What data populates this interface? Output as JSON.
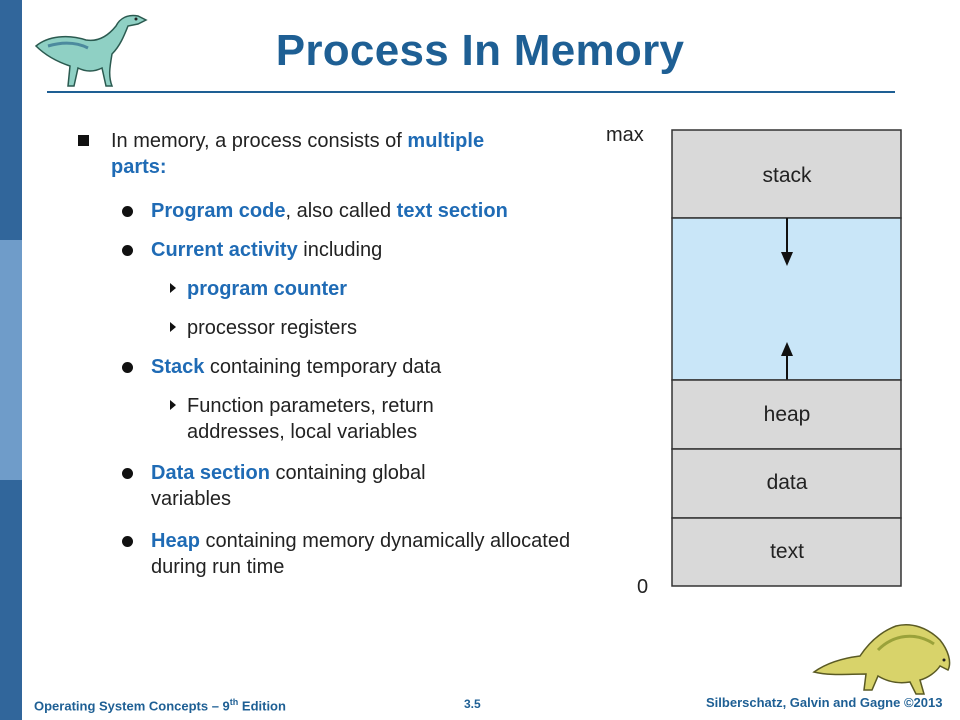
{
  "slide": {
    "title": "Process In Memory"
  },
  "content": {
    "item1": {
      "t1": "In memory, a process consists of ",
      "t2": "multiple",
      "t3": "parts:"
    },
    "item2": {
      "t1": "Program code",
      "t2": ", also called ",
      "t3": "text section"
    },
    "item3": {
      "t1": "Current activity",
      "t2": " including"
    },
    "item4": {
      "t1": "program counter"
    },
    "item5": {
      "t1": "processor registers"
    },
    "item6": {
      "t1": "Stack",
      "t2": " containing temporary data"
    },
    "item7": {
      "t1": "Function parameters, return addresses, local variables"
    },
    "item8": {
      "t1": "Data section",
      "t2": " containing global variables"
    },
    "item9": {
      "t1": "Heap",
      "t2": " containing memory dynamically allocated during run time"
    }
  },
  "memory_diagram": {
    "max_label": "max",
    "zero_label": "0",
    "segments": [
      "stack",
      "heap",
      "data",
      "text"
    ],
    "colors": {
      "segment_fill": "#d9d9d9",
      "free_space_fill": "#c9e6f8",
      "outline": "#333333"
    }
  },
  "footer": {
    "left": "Operating  System  Concepts  – 9",
    "left_sup": "th",
    "left_tail": " Edition",
    "page": "3.5",
    "right": "Silberschatz, Galvin and Gagne ©2013"
  },
  "colors": {
    "title": "#1e5f94",
    "highlight": "#1f6bb5",
    "sidebar": "#31669b"
  }
}
